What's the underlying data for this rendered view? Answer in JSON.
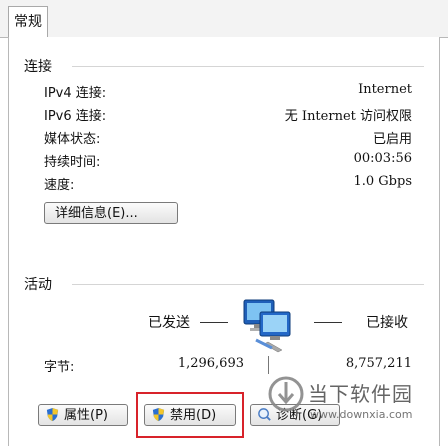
{
  "tab": {
    "label": "常规"
  },
  "connection": {
    "title": "连接",
    "rows": [
      {
        "label": "IPv4 连接:",
        "value": "Internet"
      },
      {
        "label": "IPv6 连接:",
        "value": "无 Internet 访问权限"
      },
      {
        "label": "媒体状态:",
        "value": "已启用"
      },
      {
        "label": "持续时间:",
        "value": "00:03:56"
      },
      {
        "label": "速度:",
        "value": "1.0 Gbps"
      }
    ],
    "details_button": "详细信息(E)..."
  },
  "activity": {
    "title": "活动",
    "sent_label": "已发送",
    "received_label": "已接收",
    "bytes_label": "字节:",
    "bytes_sent": "1,296,693",
    "bytes_received": "8,757,211"
  },
  "buttons": {
    "properties": "属性(P)",
    "disable": "禁用(D)",
    "diagnose": "诊断(G)"
  },
  "watermark": {
    "brand": "当下软件园",
    "url": "www.downxia.com"
  },
  "colors": {
    "highlight_box": "#d8232a",
    "shield_blue": "#2a6fd1",
    "shield_yellow": "#f3c62b"
  }
}
